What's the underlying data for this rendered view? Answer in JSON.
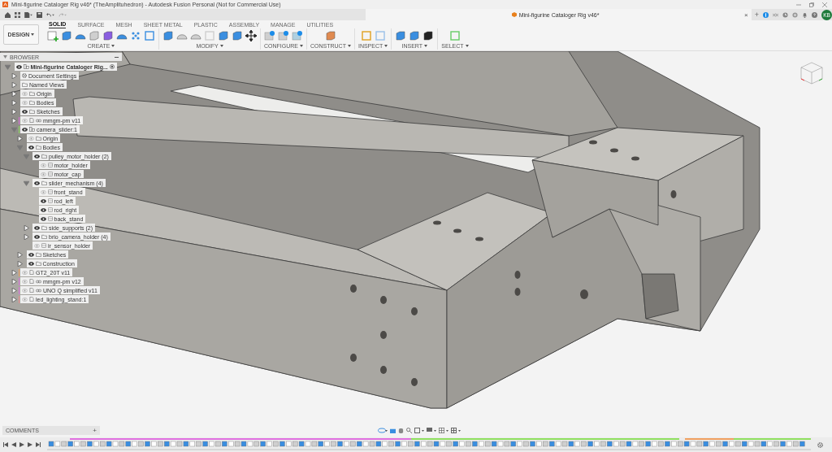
{
  "window": {
    "title": "Mini-figurine Cataloger Rig v46* (TheAmplituhedron) - Autodesk Fusion Personal (Not for Commercial Use)"
  },
  "document_tab": {
    "title": "Mini-figurine Cataloger Rig v46*",
    "close": "×"
  },
  "new_tab": "+",
  "user": {
    "initials": "KB"
  },
  "workspace": {
    "label": "DESIGN"
  },
  "ribbon_tabs": [
    {
      "label": "SOLID",
      "selected": true
    },
    {
      "label": "SURFACE",
      "selected": false
    },
    {
      "label": "MESH",
      "selected": false
    },
    {
      "label": "SHEET METAL",
      "selected": false
    },
    {
      "label": "PLASTIC",
      "selected": false
    },
    {
      "label": "ASSEMBLY",
      "selected": false
    },
    {
      "label": "MANAGE",
      "selected": false
    },
    {
      "label": "UTILITIES",
      "selected": false
    }
  ],
  "tool_groups": [
    {
      "label": "CREATE"
    },
    {
      "label": "MODIFY"
    },
    {
      "label": "CONFIGURE"
    },
    {
      "label": "CONSTRUCT"
    },
    {
      "label": "INSPECT"
    },
    {
      "label": "INSERT"
    },
    {
      "label": "SELECT"
    }
  ],
  "browser": {
    "title": "BROWSER",
    "tree": [
      {
        "label": "Mini-figurine Cataloger Rig...",
        "kind": "root",
        "visible": true,
        "expanded": true,
        "children": [
          {
            "label": "Document Settings",
            "kind": "settings",
            "expanded": false
          },
          {
            "label": "Named Views",
            "kind": "folder",
            "expanded": false
          },
          {
            "label": "Origin",
            "kind": "folder",
            "visible": false,
            "expanded": false
          },
          {
            "label": "Bodies",
            "kind": "folder",
            "visible": false,
            "expanded": false
          },
          {
            "label": "Sketches",
            "kind": "folder",
            "visible": true,
            "expanded": false
          },
          {
            "label": "mmgm-pm v11",
            "kind": "linked",
            "visible": false,
            "expanded": false,
            "color": "#e070e0"
          },
          {
            "label": "camera_slider:1",
            "kind": "component",
            "visible": true,
            "expanded": true,
            "color": "#90e060",
            "children": [
              {
                "label": "Origin",
                "kind": "folder",
                "visible": false,
                "expanded": false
              },
              {
                "label": "Bodies",
                "kind": "folder",
                "visible": true,
                "expanded": true,
                "children": [
                  {
                    "label": "pulley_motor_holder (2)",
                    "kind": "folder",
                    "visible": true,
                    "expanded": true,
                    "children": [
                      {
                        "label": "motor_holder",
                        "kind": "body",
                        "visible": false
                      },
                      {
                        "label": "motor_cap",
                        "kind": "body",
                        "visible": false
                      }
                    ]
                  },
                  {
                    "label": "slider_mechanism (4)",
                    "kind": "folder",
                    "visible": true,
                    "expanded": true,
                    "children": [
                      {
                        "label": "front_stand",
                        "kind": "body",
                        "visible": false
                      },
                      {
                        "label": "rod_left",
                        "kind": "body",
                        "visible": true
                      },
                      {
                        "label": "rod_right",
                        "kind": "body",
                        "visible": true
                      },
                      {
                        "label": "back_stand",
                        "kind": "body",
                        "visible": true
                      }
                    ]
                  },
                  {
                    "label": "side_supports (2)",
                    "kind": "folder",
                    "visible": true,
                    "expanded": false
                  },
                  {
                    "label": "brio_camera_holder (4)",
                    "kind": "folder",
                    "visible": true,
                    "expanded": false
                  },
                  {
                    "label": "ir_sensor_holder",
                    "kind": "body",
                    "visible": false
                  }
                ]
              },
              {
                "label": "Sketches",
                "kind": "folder",
                "visible": true,
                "expanded": false
              },
              {
                "label": "Construction",
                "kind": "folder",
                "visible": true,
                "expanded": false
              }
            ]
          },
          {
            "label": "GT2_20T v11",
            "kind": "part",
            "visible": false,
            "expanded": false,
            "color": "#f0a060"
          },
          {
            "label": "mmgm-pm v12",
            "kind": "linked",
            "visible": false,
            "expanded": false,
            "color": "#e070e0"
          },
          {
            "label": "UNO Q simplified v11",
            "kind": "linked",
            "visible": false,
            "expanded": false,
            "color": "#e070e0"
          },
          {
            "label": "led_lighting_stand:1",
            "kind": "part",
            "visible": false,
            "expanded": false,
            "color": "#f09090"
          }
        ]
      }
    ]
  },
  "comments": {
    "label": "COMMENTS",
    "add": "+"
  }
}
